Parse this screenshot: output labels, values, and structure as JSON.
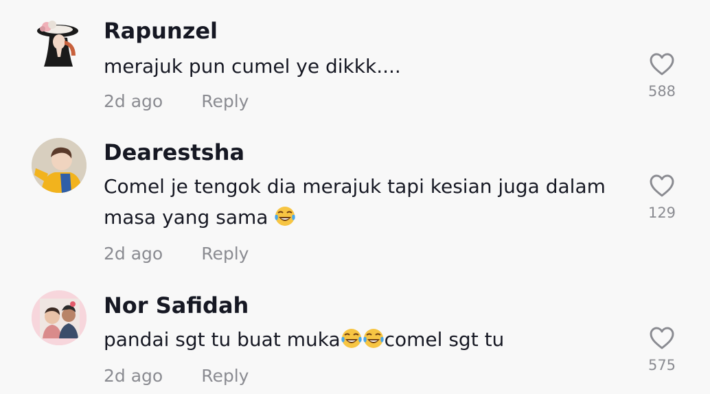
{
  "comments": [
    {
      "username": "Rapunzel",
      "text": "merajuk pun cumel ye dikkk....",
      "time": "2d ago",
      "reply_label": "Reply",
      "likes": "588",
      "avatar_icon": "illustrated-woman-in-hat"
    },
    {
      "username": "Dearestsha",
      "text": "Comel je tengok dia merajuk tapi kesian juga dalam masa yang sama",
      "emoji": "😂",
      "emoji_icon": "face-with-tears-of-joy-icon",
      "time": "2d ago",
      "reply_label": "Reply",
      "likes": "129",
      "avatar_icon": "person-in-yellow-sweater"
    },
    {
      "username": "Nor Safidah",
      "text_before": "pandai sgt tu buat muka",
      "emoji": "😂😂",
      "emoji_icon": "face-with-tears-of-joy-icon",
      "text_after": "comel sgt tu",
      "time": "2d ago",
      "reply_label": "Reply",
      "likes": "575",
      "avatar_icon": "couple-photo"
    }
  ],
  "colors": {
    "background": "#f8f8f8",
    "username": "#161823",
    "text": "#161823",
    "secondary": "#8a8b91"
  }
}
